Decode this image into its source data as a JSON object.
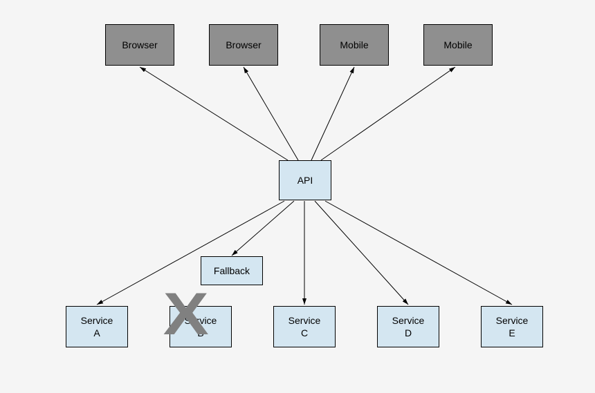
{
  "nodes": {
    "client1": "Browser",
    "client2": "Browser",
    "client3": "Mobile",
    "client4": "Mobile",
    "api": "API",
    "fallback": "Fallback",
    "serviceA": "Service\nA",
    "serviceB": "Service\nB",
    "serviceC": "Service\nC",
    "serviceD": "Service\nD",
    "serviceE": "Service\nE"
  },
  "diagram": {
    "type": "architecture",
    "description": "API gateway pattern with client fan-in and service fan-out, Service B is crossed out with Fallback",
    "edges_up": [
      "client1",
      "client2",
      "client3",
      "client4"
    ],
    "edges_down": [
      "serviceA",
      "fallback",
      "serviceC",
      "serviceD",
      "serviceE"
    ],
    "crossed_out": "serviceB"
  },
  "colors": {
    "client_fill": "#8f8f8f",
    "service_fill": "#d4e6f1",
    "cross": "#808080"
  }
}
